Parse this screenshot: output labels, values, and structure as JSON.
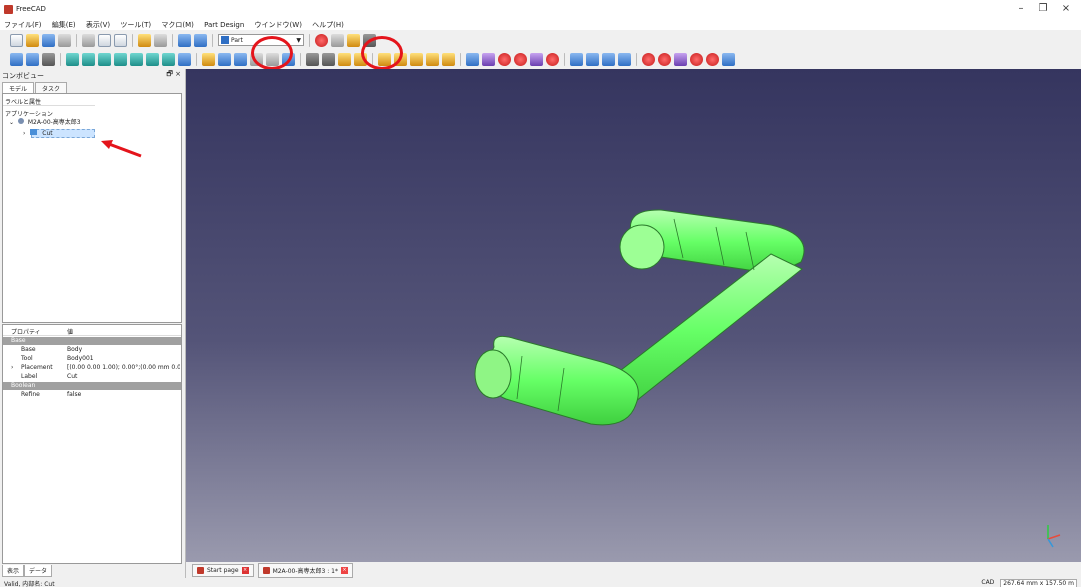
{
  "window": {
    "title": "FreeCAD",
    "minimize": "–",
    "maximize": "❐",
    "close": "×"
  },
  "menu": [
    "ファイル(F)",
    "編集(E)",
    "表示(V)",
    "ツール(T)",
    "マクロ(M)",
    "Part Design",
    "ウインドウ(W)",
    "ヘルプ(H)"
  ],
  "toolbar": {
    "workbench": "Part"
  },
  "combo_view": {
    "title": "コンボビュー",
    "buttons": "🗗 ×",
    "tabs": [
      "モデル",
      "タスク"
    ],
    "tree_header": "ラベルと属性",
    "tree_root": "アプリケーション",
    "document": "M2A-00-高専太郎3",
    "selected_item": "Cut"
  },
  "properties": {
    "header_key": "プロパティ",
    "header_value": "値",
    "rows": [
      {
        "group": true,
        "key": "Base",
        "value": ""
      },
      {
        "key": "Base",
        "value": "Body"
      },
      {
        "key": "Tool",
        "value": "Body001"
      },
      {
        "key": "Placement",
        "value": "[(0.00 0.00 1.00); 0.00°;(0.00 mm  0.0..."
      },
      {
        "key": "Label",
        "value": "Cut"
      },
      {
        "group": true,
        "key": "Boolean",
        "value": ""
      },
      {
        "key": "Refine",
        "value": "false"
      }
    ]
  },
  "bottom_tabs": [
    "表示",
    "データ"
  ],
  "doc_tabs": [
    {
      "label": "Start page"
    },
    {
      "label": "M2A-00-高専太郎3 : 1*"
    }
  ],
  "status": {
    "left": "Valid, 内部名: Cut",
    "nav": "CAD",
    "dims": "267.64 mm x 157.50 m"
  },
  "colors": {
    "model": "#66ff66",
    "annotation": "#e4141b",
    "viewport_top": "#35355f",
    "viewport_bottom": "#9a9aae"
  }
}
